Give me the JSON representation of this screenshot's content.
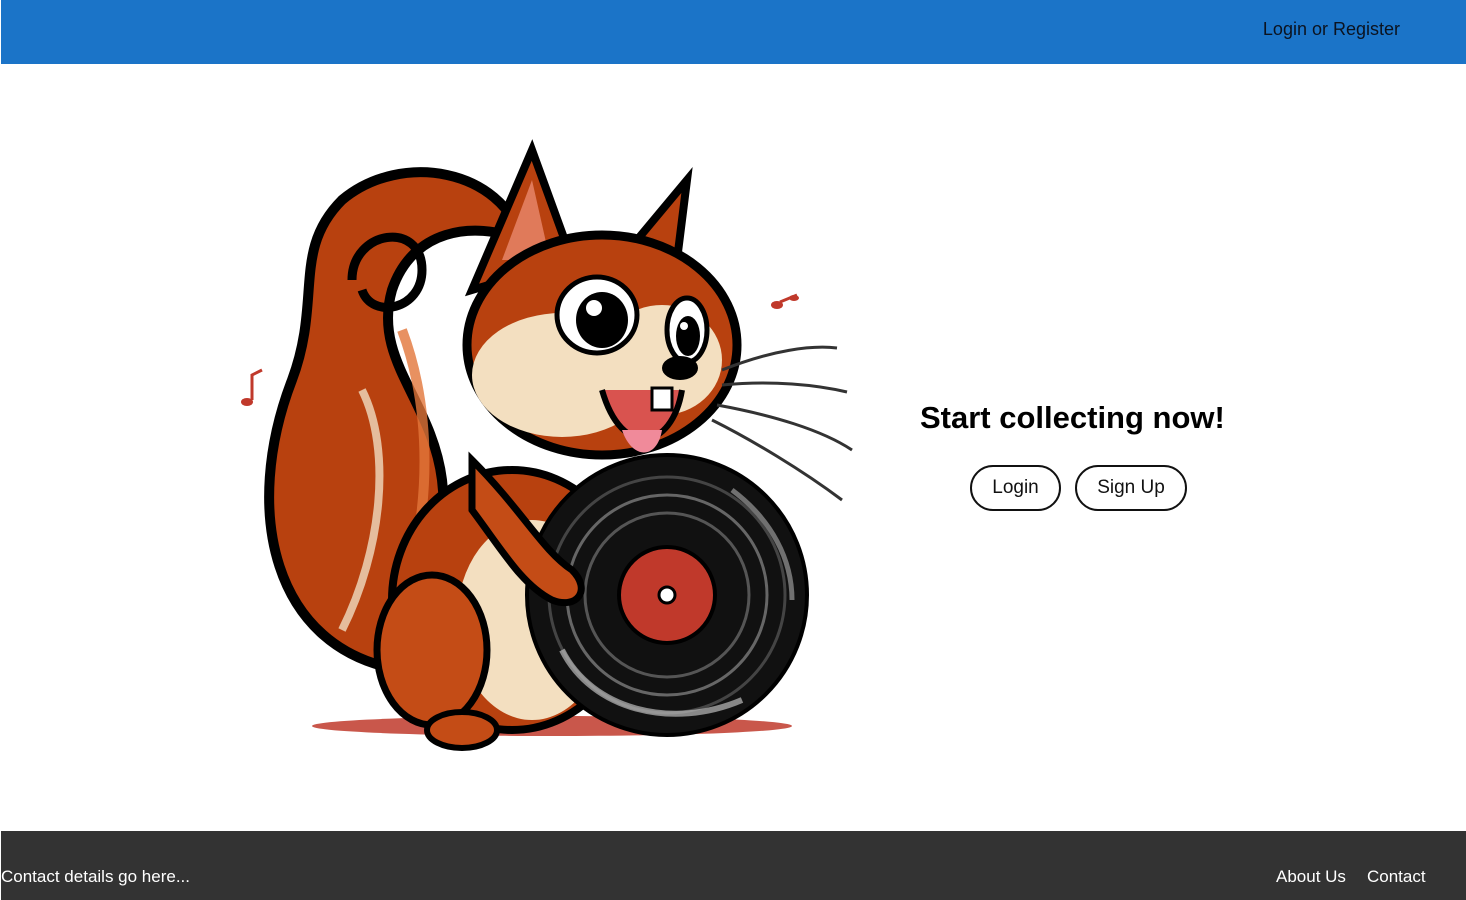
{
  "header": {
    "auth_link": "Login or Register",
    "bar_color": "#1b74c8"
  },
  "hero": {
    "image_icon": "squirrel-holding-vinyl-record-illustration",
    "heading": "Start collecting now!",
    "login_button": "Login",
    "signup_button": "Sign Up"
  },
  "footer": {
    "contact_text": "Contact details go here...",
    "links": [
      "About Us",
      "Contact"
    ],
    "bg_color": "#333333"
  }
}
